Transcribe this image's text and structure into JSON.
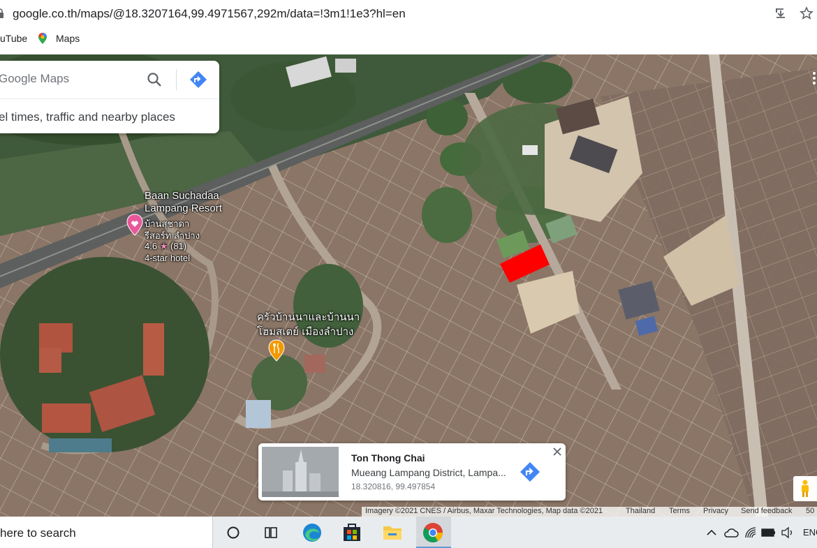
{
  "browser": {
    "url": "google.co.th/maps/@18.3207164,99.4971567,292m/data=!3m1!1e3?hl=en",
    "bookmarks": [
      {
        "label": "uTube"
      },
      {
        "label": "Maps"
      }
    ]
  },
  "search": {
    "placeholder": "Google Maps",
    "suggestion": "el times, traffic and nearby places"
  },
  "map_labels": {
    "hotel_name_en_1": "Baan Suchadaa",
    "hotel_name_en_2": "Lampang Resort",
    "hotel_name_th_1": "บ้านสุชาดา",
    "hotel_name_th_2": "รีสอร์ท ลำปาง",
    "hotel_rating": "4.6",
    "hotel_reviews": "(81)",
    "hotel_class": "4-star hotel",
    "restaurant_name_1": "ครัวบ้านนาและบ้านนา",
    "restaurant_name_2": "โฮมสเตย์ เมืองลำปาง"
  },
  "place_card": {
    "title": "Ton Thong Chai",
    "subtitle": "Mueang Lampang District, Lampa...",
    "coords": "18.320816, 99.497854"
  },
  "attribution": {
    "imagery": "Imagery ©2021 CNES / Airbus, Maxar Technologies, Map data ©2021",
    "country": "Thailand",
    "terms": "Terms",
    "privacy": "Privacy",
    "feedback": "Send feedback",
    "scale": "50"
  },
  "taskbar": {
    "search_text": "here to search",
    "lang": "ENG"
  },
  "colors": {
    "marker_red": "#ff0000",
    "directions_blue": "#4285f4",
    "hotel_pin_pink": "#e8579a",
    "restaurant_pin_orange": "#f29900"
  }
}
